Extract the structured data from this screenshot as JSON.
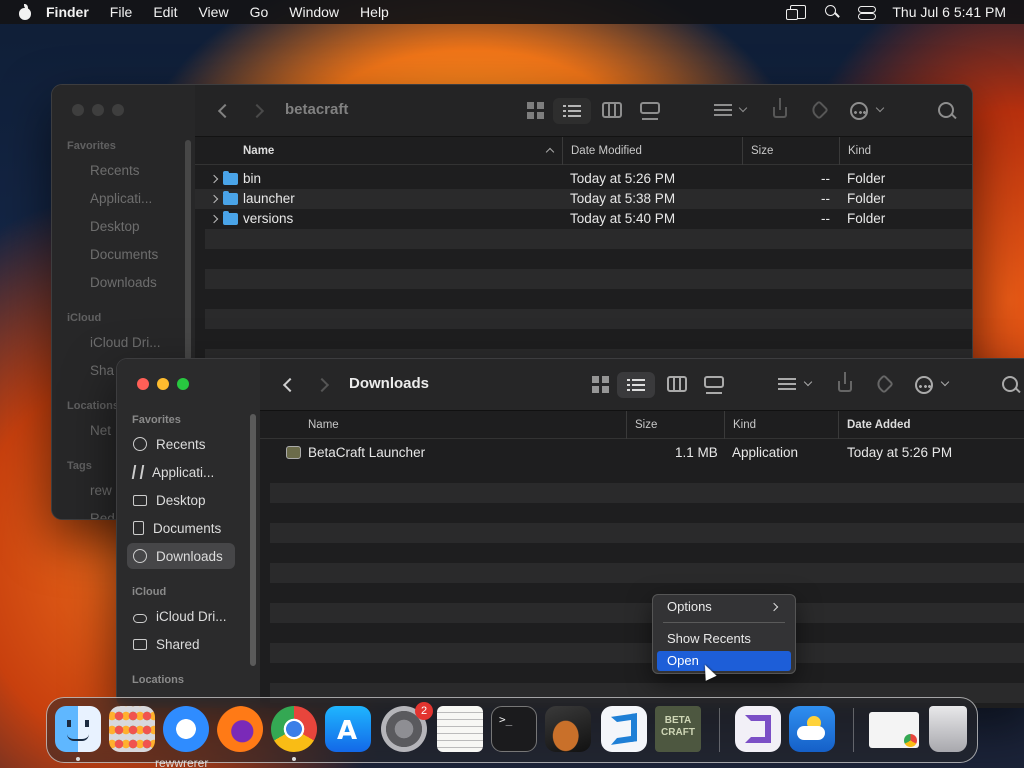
{
  "menubar": {
    "app": "Finder",
    "items": [
      "File",
      "Edit",
      "View",
      "Go",
      "Window",
      "Help"
    ],
    "clock": "Thu Jul 6  5:41 PM"
  },
  "back_window": {
    "title": "betacraft",
    "sidebar": {
      "favorites_head": "Favorites",
      "favorites": [
        "Recents",
        "Applicati...",
        "Desktop",
        "Documents",
        "Downloads"
      ],
      "icloud_head": "iCloud",
      "icloud": [
        "iCloud Dri...",
        "Sha"
      ],
      "locations_head": "Locations",
      "locations": [
        "Net"
      ],
      "tags_head": "Tags",
      "tags": [
        "rew",
        "Red"
      ]
    },
    "columns": [
      "Name",
      "Date Modified",
      "Size",
      "Kind"
    ],
    "rows": [
      {
        "name": "bin",
        "date": "Today at 5:26 PM",
        "size": "--",
        "kind": "Folder"
      },
      {
        "name": "launcher",
        "date": "Today at 5:38 PM",
        "size": "--",
        "kind": "Folder"
      },
      {
        "name": "versions",
        "date": "Today at 5:40 PM",
        "size": "--",
        "kind": "Folder"
      }
    ]
  },
  "front_window": {
    "title": "Downloads",
    "sidebar": {
      "favorites_head": "Favorites",
      "favorites": [
        "Recents",
        "Applicati...",
        "Desktop",
        "Documents",
        "Downloads"
      ],
      "icloud_head": "iCloud",
      "icloud": [
        "iCloud Dri...",
        "Shared"
      ],
      "locations_head": "Locations"
    },
    "columns": [
      "Name",
      "Size",
      "Kind",
      "Date Added"
    ],
    "rows": [
      {
        "name": "BetaCraft Launcher",
        "size": "1.1 MB",
        "kind": "Application",
        "date": "Today at 5:26 PM"
      }
    ]
  },
  "context_menu": {
    "items": [
      "Options",
      "Show Recents",
      "Open"
    ],
    "selected": "Open"
  },
  "dock": {
    "items": [
      "finder-icon",
      "launchpad-icon",
      "safari-icon",
      "firefox-icon",
      "chrome-icon",
      "app-store-icon",
      "system-settings-icon",
      "textedit-icon",
      "terminal-icon",
      "garageband-icon",
      "vscode-icon",
      "betacraft-icon",
      "visual-studio-icon",
      "weather-icon",
      "preview-window-icon",
      "trash-icon"
    ],
    "settings_badge": "2",
    "betacraft_label": "BETA CRAFT",
    "below_text": "rewwrerer"
  }
}
